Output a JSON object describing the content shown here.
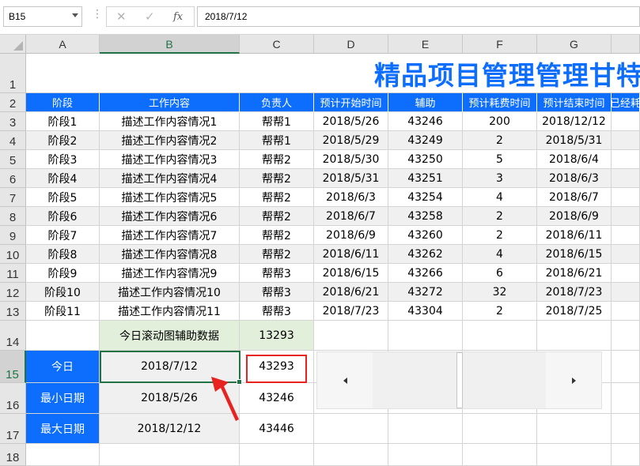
{
  "formula_bar": {
    "name_box": "B15",
    "cancel_icon": "✕",
    "enter_icon": "✓",
    "fx_label": "fx",
    "formula": "2018/7/12"
  },
  "columns": [
    "A",
    "B",
    "C",
    "D",
    "E",
    "F",
    "G"
  ],
  "rows": [
    "1",
    "2",
    "3",
    "4",
    "5",
    "6",
    "7",
    "8",
    "9",
    "10",
    "11",
    "12",
    "13",
    "14",
    "15",
    "16",
    "17",
    "18"
  ],
  "title": "精品项目管理管理甘特图",
  "headers": [
    "阶段",
    "工作内容",
    "负责人",
    "预计开始时间",
    "辅助",
    "预计耗费时间",
    "预计结束时间",
    "已经耗"
  ],
  "tasks": [
    [
      "阶段1",
      "描述工作内容情况1",
      "帮帮1",
      "2018/5/26",
      "43246",
      "200",
      "2018/12/12"
    ],
    [
      "阶段2",
      "描述工作内容情况2",
      "帮帮1",
      "2018/5/29",
      "43249",
      "2",
      "2018/5/31"
    ],
    [
      "阶段3",
      "描述工作内容情况3",
      "帮帮2",
      "2018/5/30",
      "43250",
      "5",
      "2018/6/4"
    ],
    [
      "阶段4",
      "描述工作内容情况4",
      "帮帮2",
      "2018/5/31",
      "43251",
      "3",
      "2018/6/3"
    ],
    [
      "阶段5",
      "描述工作内容情况5",
      "帮帮2",
      "2018/6/3",
      "43254",
      "4",
      "2018/6/7"
    ],
    [
      "阶段6",
      "描述工作内容情况6",
      "帮帮2",
      "2018/6/7",
      "43258",
      "2",
      "2018/6/9"
    ],
    [
      "阶段7",
      "描述工作内容情况7",
      "帮帮2",
      "2018/6/9",
      "43260",
      "2",
      "2018/6/11"
    ],
    [
      "阶段8",
      "描述工作内容情况8",
      "帮帮2",
      "2018/6/11",
      "43262",
      "4",
      "2018/6/15"
    ],
    [
      "阶段9",
      "描述工作内容情况9",
      "帮帮3",
      "2018/6/15",
      "43266",
      "6",
      "2018/6/21"
    ],
    [
      "阶段10",
      "描述工作内容情况10",
      "帮帮3",
      "2018/6/21",
      "43272",
      "32",
      "2018/7/23"
    ],
    [
      "阶段11",
      "描述工作内容情况11",
      "帮帮3",
      "2018/7/23",
      "43304",
      "2",
      "2018/7/25"
    ]
  ],
  "helper": {
    "label": "今日滚动图辅助数据",
    "value": "13293"
  },
  "summary": [
    {
      "label": "今日",
      "date": "2018/7/12",
      "serial": "43293"
    },
    {
      "label": "最小日期",
      "date": "2018/5/26",
      "serial": "43246"
    },
    {
      "label": "最大日期",
      "date": "2018/12/12",
      "serial": "43446"
    }
  ],
  "scrollbar": {
    "position": 0.5
  }
}
